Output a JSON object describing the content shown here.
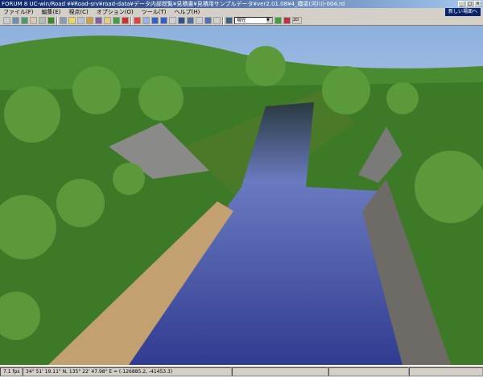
{
  "window": {
    "title": "FORUM 8   UC-win/Road   ¥¥Road-srv¥road-data¥データ内部閲覧¥見積書¥見積用サンプルデータ¥ver2.01.08¥4_橋梁(河川)-004.rd",
    "min": "_",
    "max": "□",
    "close": "×"
  },
  "menu": [
    "ファイル(F)",
    "編集(E)",
    "視点(C)",
    "オプション(O)",
    "ツール(T)",
    "ヘルプ(H)"
  ],
  "new_button": "新しい場面へ",
  "toolbar": {
    "time_select": "現在",
    "label_2d": "2D"
  },
  "status": {
    "fps": "7.1 fps",
    "coords": "34°  51' 19.11\" N, 135°  22' 47.98\" E  =  (-126885.2, -41453.3)"
  },
  "colors": {
    "title_start": "#0a246a",
    "title_end": "#a6caf0",
    "water": "#4a5aa8",
    "grass": "#3d8a2a",
    "sky": "#b9cde8"
  }
}
